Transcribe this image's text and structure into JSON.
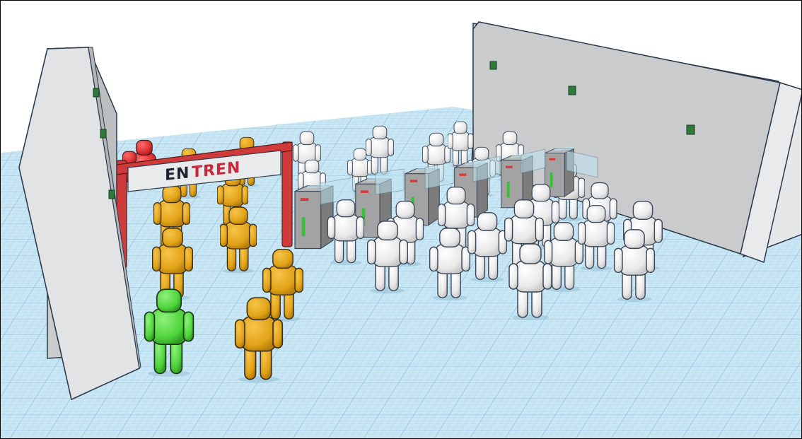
{
  "scene": {
    "sign": {
      "text_left": "EN",
      "text_right": "TREN"
    },
    "colors": {
      "grid_light": "#c6e3f1",
      "grid_line": "#9ccbe2",
      "wall": "#e4e6e8",
      "wall_dark": "#b7b9bb",
      "outline": "#2b3a4a",
      "arch_red": "#cf3a3a",
      "person_white": "#f2f2f2",
      "person_orange": "#e2a317",
      "person_green": "#4fd43c",
      "person_red": "#dd3030",
      "turnstile": "#9c9c9c",
      "indicator_green": "#3bbf3b",
      "indicator_red": "#d63a3a"
    }
  }
}
